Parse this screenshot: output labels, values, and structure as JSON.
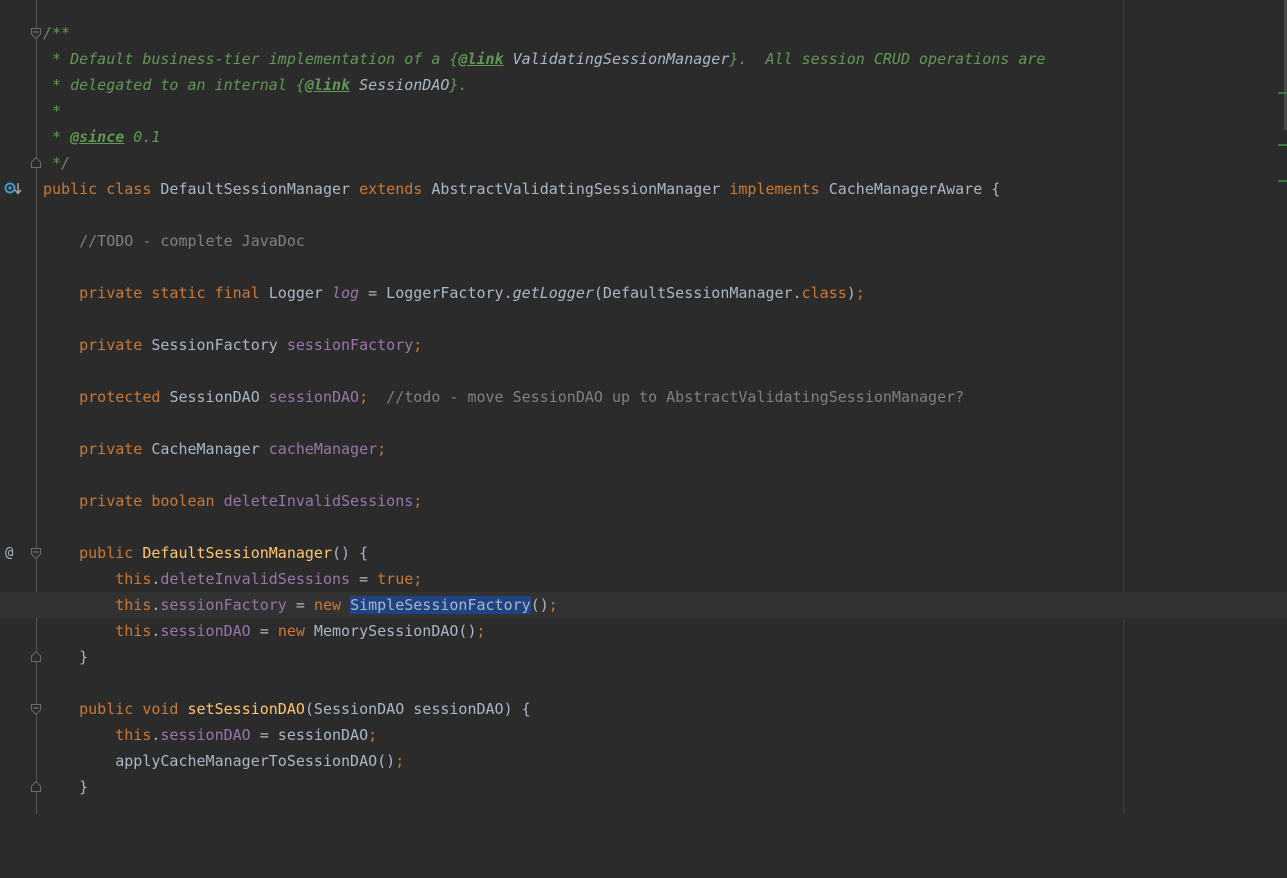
{
  "editor": {
    "language": "Java",
    "colors": {
      "background": "#2b2b2b",
      "keyword": "#cc7832",
      "field": "#9876aa",
      "method": "#ffc66d",
      "doc_comment": "#629755",
      "line_comment": "#808080",
      "selection": "#214283"
    },
    "doc": {
      "open": "/**",
      "l1_a": " * Default business-tier implementation of a {",
      "l1_tag": "@link",
      "l1_ref": " ValidatingSessionManager",
      "l1_b": "}.  All session CRUD operations are",
      "l2_a": " * delegated to an internal {",
      "l2_tag": "@link",
      "l2_ref": " SessionDAO",
      "l2_b": "}.",
      "l3": " *",
      "l4_a": " * ",
      "l4_tag": "@since",
      "l4_b": " 0.1",
      "close": " */"
    },
    "class_decl": {
      "public": "public",
      "class": "class",
      "name": "DefaultSessionManager",
      "extends": "extends",
      "super": "AbstractValidatingSessionManager",
      "implements": "implements",
      "iface": "CacheManagerAware",
      "brace": " {"
    },
    "todo": "//TODO - complete JavaDoc",
    "log_decl": {
      "mods": "private static final",
      "type": "Logger",
      "name": "log",
      "eq": " = LoggerFactory.",
      "call": "getLogger",
      "args": "(DefaultSessionManager.",
      "cls": "class",
      "end": ")",
      "semi": ";"
    },
    "sf_decl": {
      "mods": "private",
      "type": "SessionFactory",
      "name": "sessionFactory",
      "semi": ";"
    },
    "dao_decl": {
      "mods": "protected",
      "type": "SessionDAO",
      "name": "sessionDAO",
      "semi": ";",
      "comment": "//todo - move SessionDAO up to AbstractValidatingSessionManager?"
    },
    "cm_decl": {
      "mods": "private",
      "type": "CacheManager",
      "name": "cacheManager",
      "semi": ";"
    },
    "dis_decl": {
      "mods": "private",
      "type": "boolean",
      "name": "deleteInvalidSessions",
      "semi": ";"
    },
    "ctor": {
      "mods": "public",
      "name": "DefaultSessionManager",
      "sig": "() {",
      "s1_this": "this",
      "s1_field": "deleteInvalidSessions",
      "s1_eq": " = ",
      "s1_val": "true",
      "s2_this": "this",
      "s2_field": "sessionFactory",
      "s2_eq": " = ",
      "s2_new": "new",
      "s2_cls": "SimpleSessionFactory",
      "s2_end": "()",
      "s3_this": "this",
      "s3_field": "sessionDAO",
      "s3_eq": " = ",
      "s3_new": "new",
      "s3_cls": " MemorySessionDAO()",
      "close": "}"
    },
    "setter": {
      "mods": "public void",
      "name": "setSessionDAO",
      "sig": "(SessionDAO sessionDAO) {",
      "s1_this": "this",
      "s1_field": "sessionDAO",
      "s1_eq": " = sessionDAO",
      "s2": "applyCacheManagerToSessionDAO()",
      "close": "}"
    },
    "semi": ";",
    "dot": ".",
    "gutter": {
      "override_icon": "implements-gutter-icon",
      "annotation_icon_text": "@"
    }
  }
}
